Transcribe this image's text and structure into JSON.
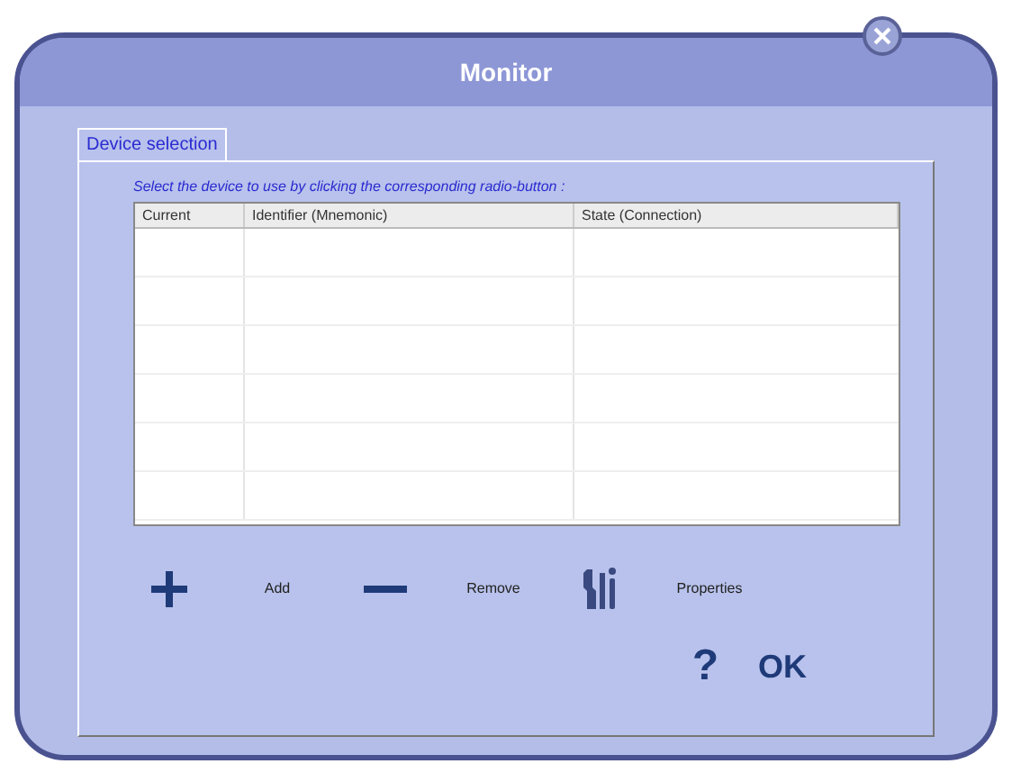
{
  "window": {
    "title": "Monitor"
  },
  "tabs": [
    {
      "label": "Device selection",
      "selected": true
    }
  ],
  "instruction": "Select the device to use by clicking the corresponding radio-button :",
  "table": {
    "columns": [
      "Current",
      "Identifier (Mnemonic)",
      "State (Connection)"
    ]
  },
  "actions": [
    {
      "kind": "add",
      "label": "Add"
    },
    {
      "kind": "remove",
      "label": "Remove"
    },
    {
      "kind": "properties",
      "label": "Properties"
    }
  ],
  "footer": {
    "help": "?",
    "ok": "OK"
  }
}
